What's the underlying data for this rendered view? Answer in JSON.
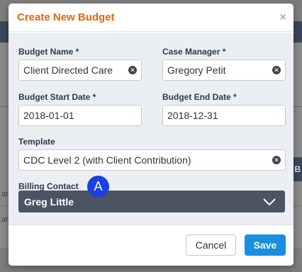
{
  "background": {
    "right_col_char": "B",
    "left_fragment": "are"
  },
  "modal": {
    "title": "Create New Budget",
    "close_glyph": "×"
  },
  "form": {
    "budget_name": {
      "label": "Budget Name *",
      "value": "Client Directed Care"
    },
    "case_manager": {
      "label": "Case Manager *",
      "value": "Gregory Petit"
    },
    "start_date": {
      "label": "Budget Start Date *",
      "value": "2018-01-01"
    },
    "end_date": {
      "label": "Budget End Date *",
      "value": "2018-12-31"
    },
    "template": {
      "label": "Template",
      "value": "CDC Level 2 (with Client Contribution)"
    },
    "billing_contact": {
      "label": "Billing Contact",
      "value": "Greg Little"
    }
  },
  "annotation": {
    "marker": "A"
  },
  "footer": {
    "cancel_label": "Cancel",
    "save_label": "Save"
  },
  "colors": {
    "title": "#e8640c",
    "save": "#1a8ee0",
    "select_bg": "#4b5562",
    "marker": "#1d3fe0"
  }
}
